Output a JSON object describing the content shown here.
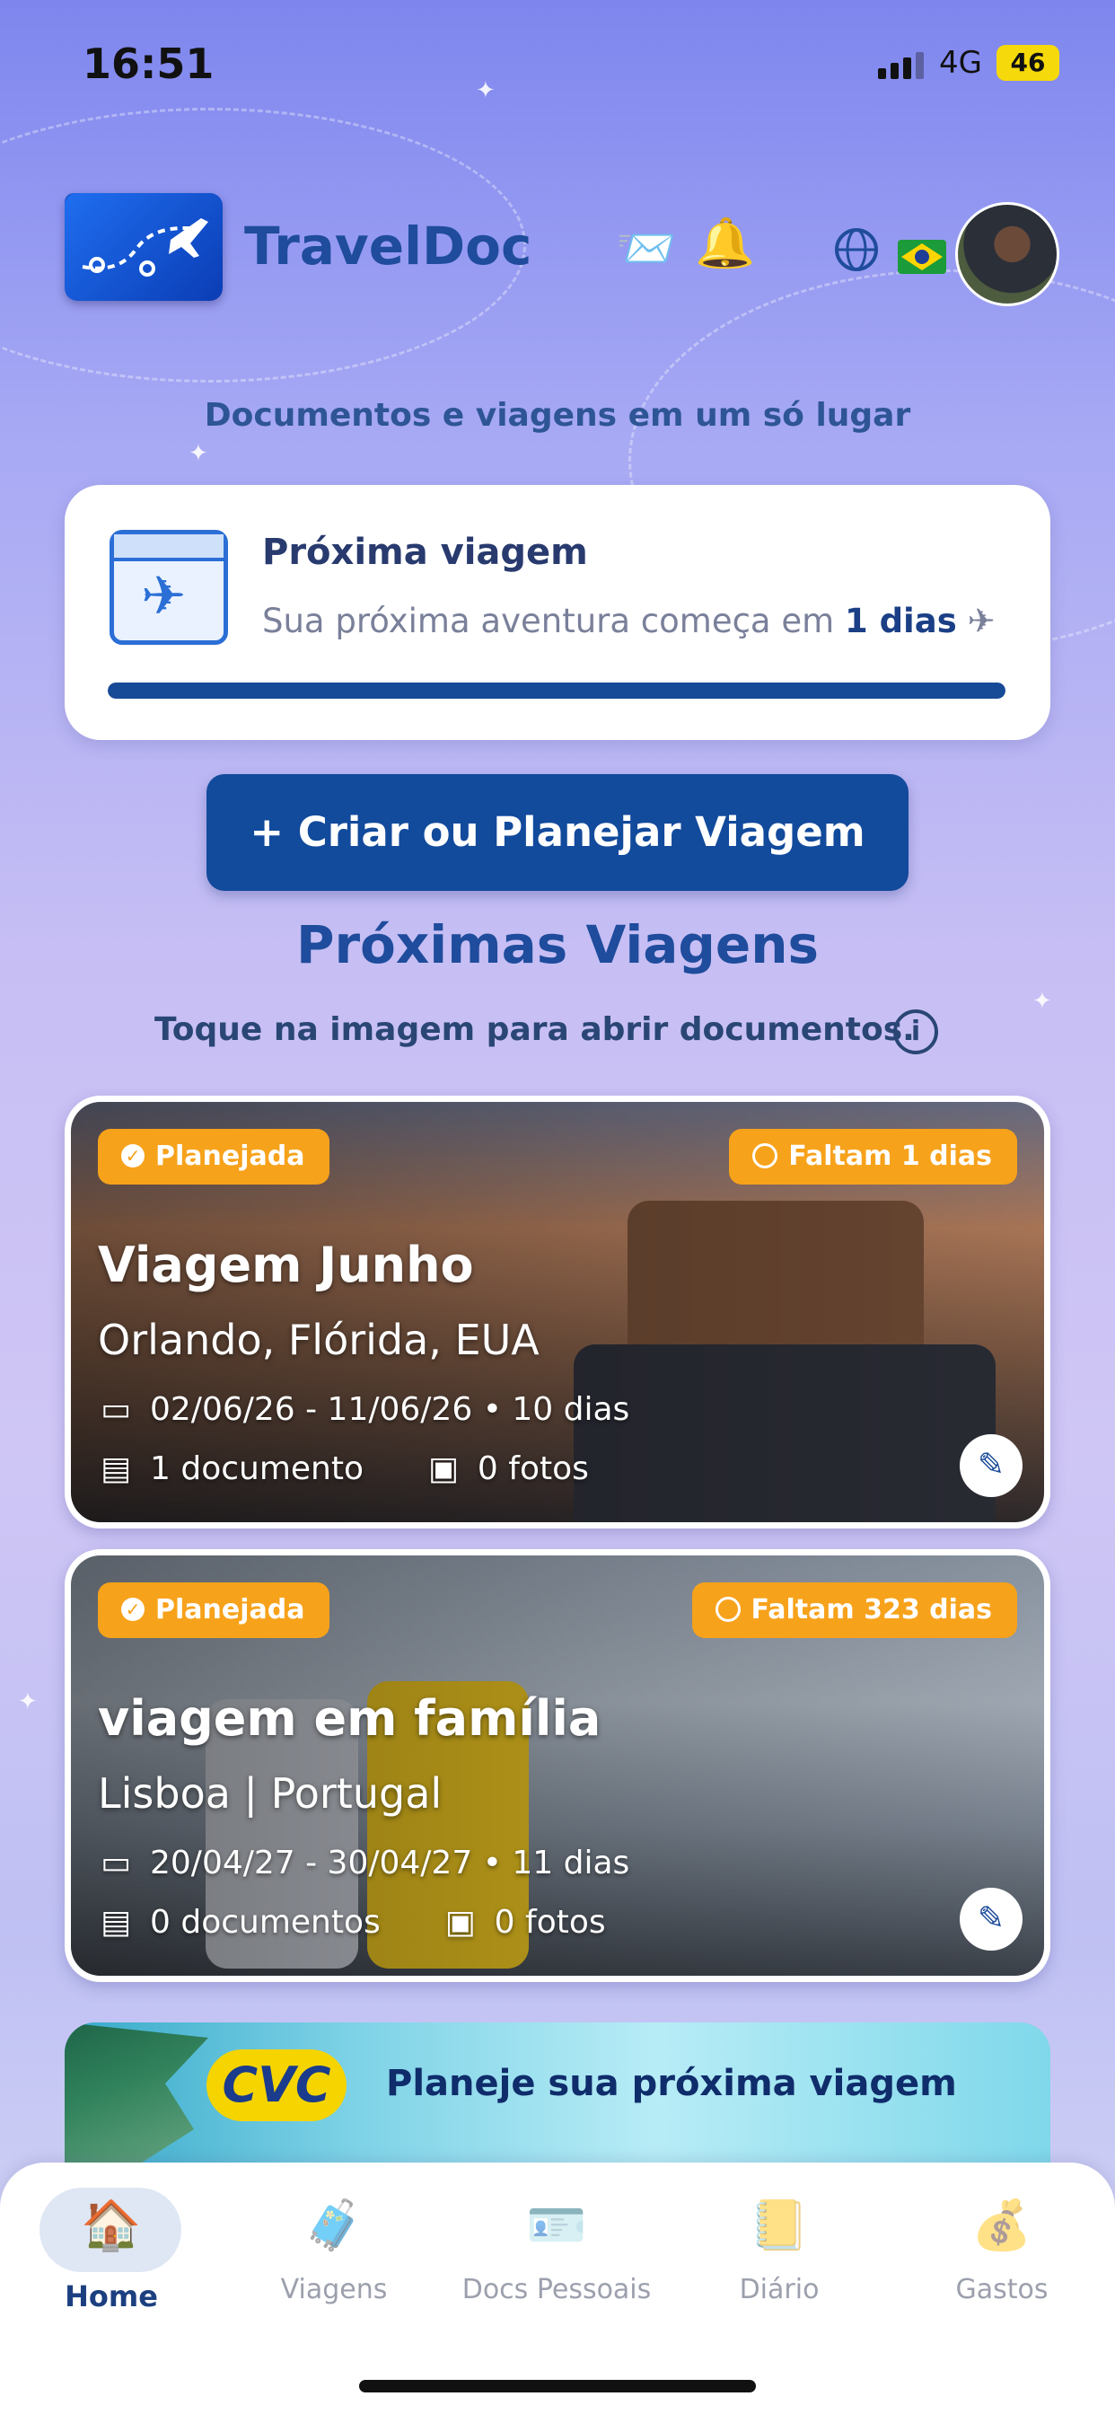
{
  "status_bar": {
    "time": "16:51",
    "network": "4G",
    "battery": "46"
  },
  "header": {
    "app_name": "TravelDoc",
    "tagline": "Documentos e viagens em um só lugar",
    "icons": [
      "mail-card-icon",
      "bell-icon",
      "globe-icon",
      "brazil-flag-icon"
    ]
  },
  "next_trip": {
    "title": "Próxima viagem",
    "subtitle_prefix": "Sua próxima aventura começa em",
    "days_label": "1 dias",
    "progress": 1.0
  },
  "create_button": "+ Criar ou Planejar Viagem",
  "section_title": "Próximas Viagens",
  "hint": "Toque na imagem para abrir documentos.",
  "trips": [
    {
      "status": "Planejada",
      "countdown": "Faltam 1 dias",
      "name": "Viagem Junho",
      "place": "Orlando, Flórida, EUA",
      "dates": "02/06/26 - 11/06/26 • 10 dias",
      "documents": "1 documento",
      "photos": "0 fotos"
    },
    {
      "status": "Planejada",
      "countdown": "Faltam 323 dias",
      "name": "viagem em família",
      "place": "Lisboa | Portugal",
      "dates": "20/04/27 - 30/04/27 • 11 dias",
      "documents": "0 documentos",
      "photos": "0 fotos"
    }
  ],
  "banner": {
    "brand": "CVC",
    "text": "Planeje sua próxima viagem"
  },
  "tabs": [
    {
      "label": "Home",
      "active": true
    },
    {
      "label": "Viagens",
      "active": false
    },
    {
      "label": "Docs Pessoais",
      "active": false
    },
    {
      "label": "Diário",
      "active": false
    },
    {
      "label": "Gastos",
      "active": false
    }
  ],
  "colors": {
    "primary": "#124a9c",
    "accent": "#f7a21b",
    "title": "#1f4c9c"
  }
}
